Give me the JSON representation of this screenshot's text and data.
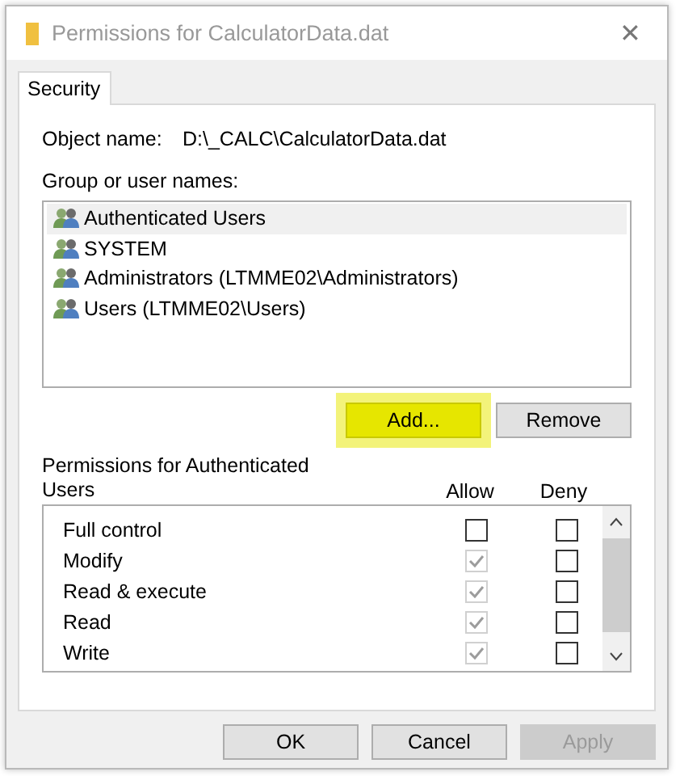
{
  "window": {
    "title": "Permissions for CalculatorData.dat",
    "close": "✕"
  },
  "tabs": [
    {
      "label": "Security",
      "selected": true
    }
  ],
  "object_name": {
    "label": "Object name:",
    "value": "D:\\_CALC\\CalculatorData.dat"
  },
  "group_list": {
    "label": "Group or user names:",
    "items": [
      {
        "name": "Authenticated Users",
        "selected": true
      },
      {
        "name": "SYSTEM",
        "selected": false
      },
      {
        "name": "Administrators (LTMME02\\Administrators)",
        "selected": false
      },
      {
        "name": "Users (LTMME02\\Users)",
        "selected": false
      }
    ]
  },
  "group_buttons": [
    {
      "label": "Add...",
      "highlighted": true
    },
    {
      "label": "Remove",
      "highlighted": false
    }
  ],
  "permissions": {
    "label": "Permissions for Authenticated Users",
    "allow_header": "Allow",
    "deny_header": "Deny",
    "rows": [
      {
        "name": "Full control",
        "allow": {
          "checked": false,
          "disabled": false
        },
        "deny": {
          "checked": false,
          "disabled": false
        }
      },
      {
        "name": "Modify",
        "allow": {
          "checked": true,
          "disabled": true
        },
        "deny": {
          "checked": false,
          "disabled": false
        }
      },
      {
        "name": "Read & execute",
        "allow": {
          "checked": true,
          "disabled": true
        },
        "deny": {
          "checked": false,
          "disabled": false
        }
      },
      {
        "name": "Read",
        "allow": {
          "checked": true,
          "disabled": true
        },
        "deny": {
          "checked": false,
          "disabled": false
        }
      },
      {
        "name": "Write",
        "allow": {
          "checked": true,
          "disabled": true
        },
        "deny": {
          "checked": false,
          "disabled": false
        }
      }
    ]
  },
  "footer_buttons": [
    {
      "label": "OK",
      "disabled": false
    },
    {
      "label": "Cancel",
      "disabled": false
    },
    {
      "label": "Apply",
      "disabled": true
    }
  ]
}
